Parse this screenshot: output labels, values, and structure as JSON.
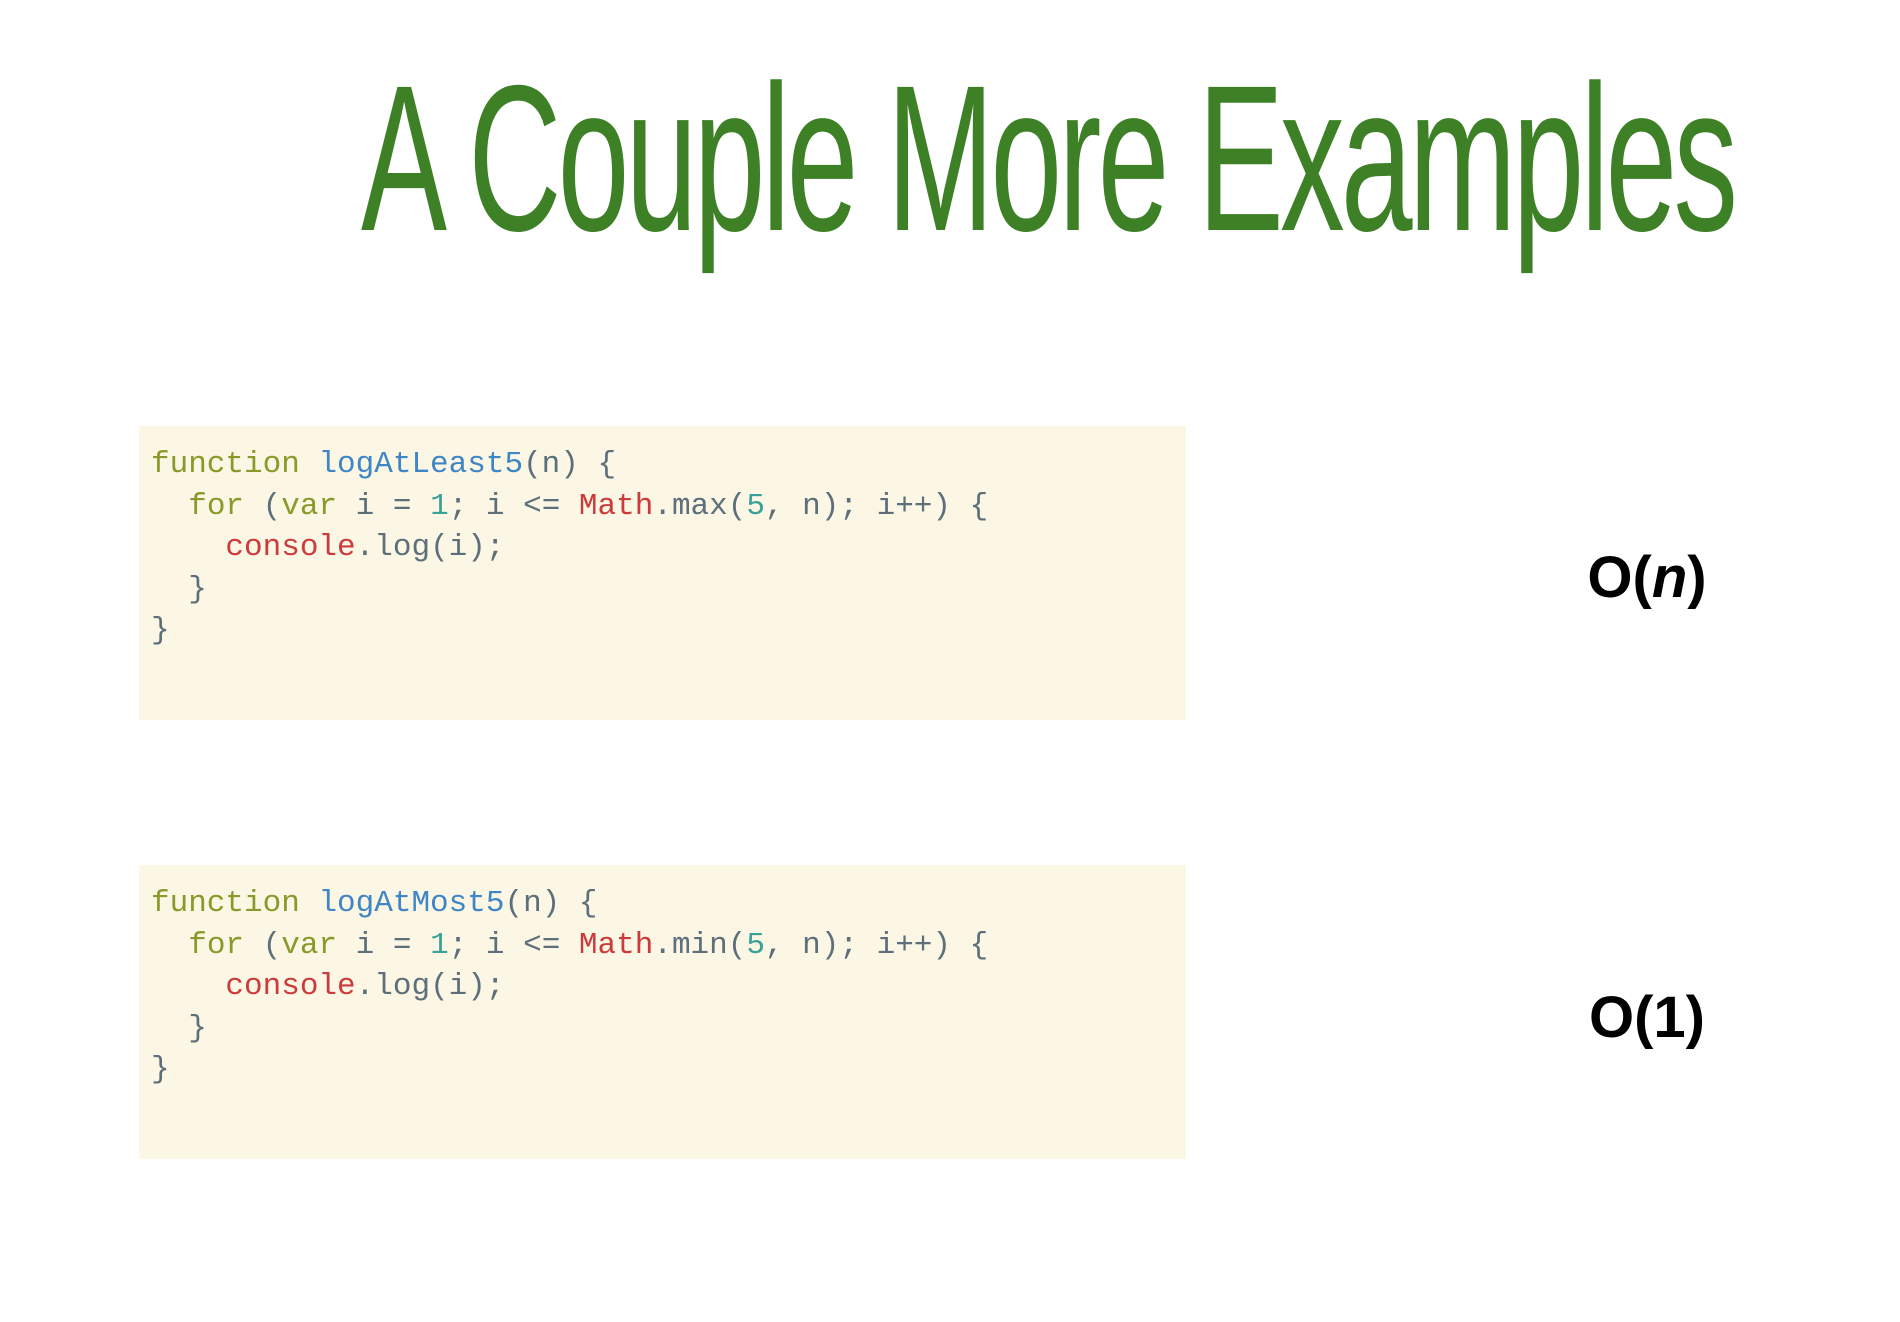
{
  "slide": {
    "title": "A Couple More Examples"
  },
  "examples": [
    {
      "code": {
        "line1": {
          "kw": "function",
          "name": "logAtLeast5",
          "rest": "(n) {"
        },
        "line2": {
          "indent": "  ",
          "kw_for": "for",
          "open": " (",
          "kw_var": "var",
          "mid": " i = ",
          "num1": "1",
          "mid2": "; i <= ",
          "builtin": "Math",
          "call": ".max(",
          "num2": "5",
          "tail": ", n); i++) {"
        },
        "line3": {
          "indent": "    ",
          "builtin": "console",
          "rest": ".log(i);"
        },
        "line4": "  }",
        "line5": "}"
      },
      "complexity": {
        "prefix": "O(",
        "var": "n",
        "suffix": ")"
      }
    },
    {
      "code": {
        "line1": {
          "kw": "function",
          "name": "logAtMost5",
          "rest": "(n) {"
        },
        "line2": {
          "indent": "  ",
          "kw_for": "for",
          "open": " (",
          "kw_var": "var",
          "mid": " i = ",
          "num1": "1",
          "mid2": "; i <= ",
          "builtin": "Math",
          "call": ".min(",
          "num2": "5",
          "tail": ", n); i++) {"
        },
        "line3": {
          "indent": "    ",
          "builtin": "console",
          "rest": ".log(i);"
        },
        "line4": "  }",
        "line5": "}"
      },
      "complexity": {
        "text": "O(1)"
      }
    }
  ],
  "colors": {
    "title": "#3d8026",
    "code_background": "#fcf6e4",
    "keyword": "#8a9a2a",
    "function_name": "#3f86c6",
    "builtin": "#cc3b3b",
    "number": "#3aa198",
    "punctuation": "#5c6f7a"
  }
}
